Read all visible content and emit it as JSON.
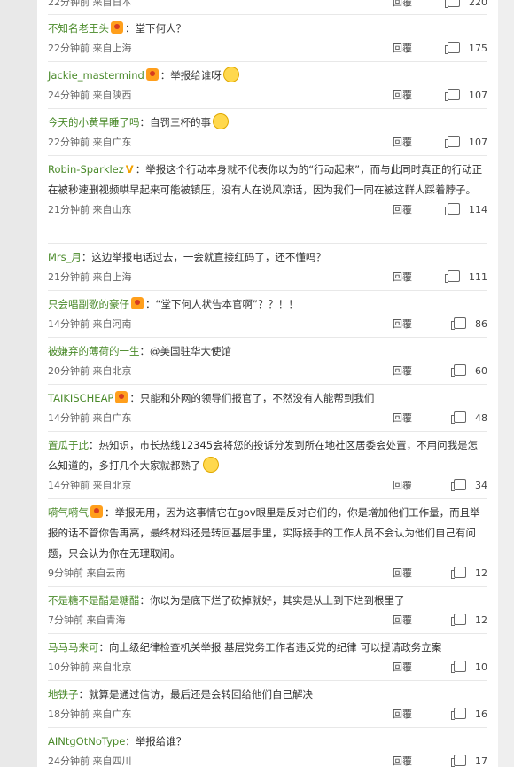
{
  "ui": {
    "reply_label": "回覆"
  },
  "top_partial": {
    "meta": "22分钟前 来自日本",
    "likes": "220"
  },
  "comments": [
    {
      "user": "不知名老王头",
      "badge": true,
      "text": "堂下何人？",
      "meta": "22分钟前 来自上海",
      "likes": "175"
    },
    {
      "user": "Jackie_mastermind",
      "badge": true,
      "text": "举报给谁呀",
      "emoji": true,
      "meta": "24分钟前 来自陕西",
      "likes": "107"
    },
    {
      "user": "今天的小黄早睡了吗",
      "text": "自罚三杯的事",
      "emoji": true,
      "meta": "22分钟前 来自广东",
      "likes": "107"
    },
    {
      "user": "Robin-Sparklez",
      "vbadge": "V",
      "text": "举报这个行动本身就不代表你以为的“行动起来”，而与此同时真正的行动正在被秒速删视频哄早起来可能被镇压，没有人在说风凉话，因为我们一同在被这群人踩着脖子。",
      "meta": "21分钟前 来自山东",
      "likes": "114"
    },
    {
      "user": "Mrs_月",
      "text": "这边举报电话过去，一会就直接红码了，还不懂吗？",
      "meta": "21分钟前 来自上海",
      "likes": "111"
    },
    {
      "user": "只会唱副歌的豪仔",
      "badge": true,
      "text": "“堂下何人状告本官啊”？？！！",
      "meta": "14分钟前 来自河南",
      "likes": "86"
    },
    {
      "user": "被嫌弃的薄荷的一生",
      "text": "@美国驻华大使馆",
      "meta": "20分钟前 来自北京",
      "likes": "60"
    },
    {
      "user": "TAIKISCHEAP",
      "badge": true,
      "text": "只能和外网的领导们报官了，不然没有人能帮到我们",
      "meta": "14分钟前 来自广东",
      "likes": "48"
    },
    {
      "user": "置瓜于此",
      "text": "热知识，市长热线12345会将您的投诉分发到所在地社区居委会处置，不用问我是怎么知道的，多打几个大家就都熟了",
      "emoji": true,
      "meta": "14分钟前 来自北京",
      "likes": "34"
    },
    {
      "user": "嗬气嗬气",
      "badge": true,
      "text": "举报无用，因为这事情它在gov眼里是反对它们的，你是增加他们工作量，而且举报的话不管你告再高，最终材料还是转回基层手里，实际接手的工作人员不会认为他们自己有问题，只会认为你在无理取闹。",
      "meta": "9分钟前 来自云南",
      "likes": "12"
    },
    {
      "user": "不是糖不是醋是糖醋",
      "text": "你以为是底下烂了砍掉就好，其实是从上到下烂到根里了",
      "meta": "7分钟前 来自青海",
      "likes": "12"
    },
    {
      "user": "马马马来可",
      "text": "向上级纪律检查机关举报 基层党务工作者违反党的纪律 可以提请政务立案",
      "meta": "10分钟前 来自北京",
      "likes": "10"
    },
    {
      "user": "地铁子",
      "text": "就算是通过信访，最后还是会转回给他们自己解决",
      "meta": "18分钟前 来自广东",
      "likes": "16"
    },
    {
      "user": "AINtgOtNoType",
      "text": "举报给谁？",
      "meta": "24分钟前 来自四川",
      "likes": "17"
    }
  ]
}
